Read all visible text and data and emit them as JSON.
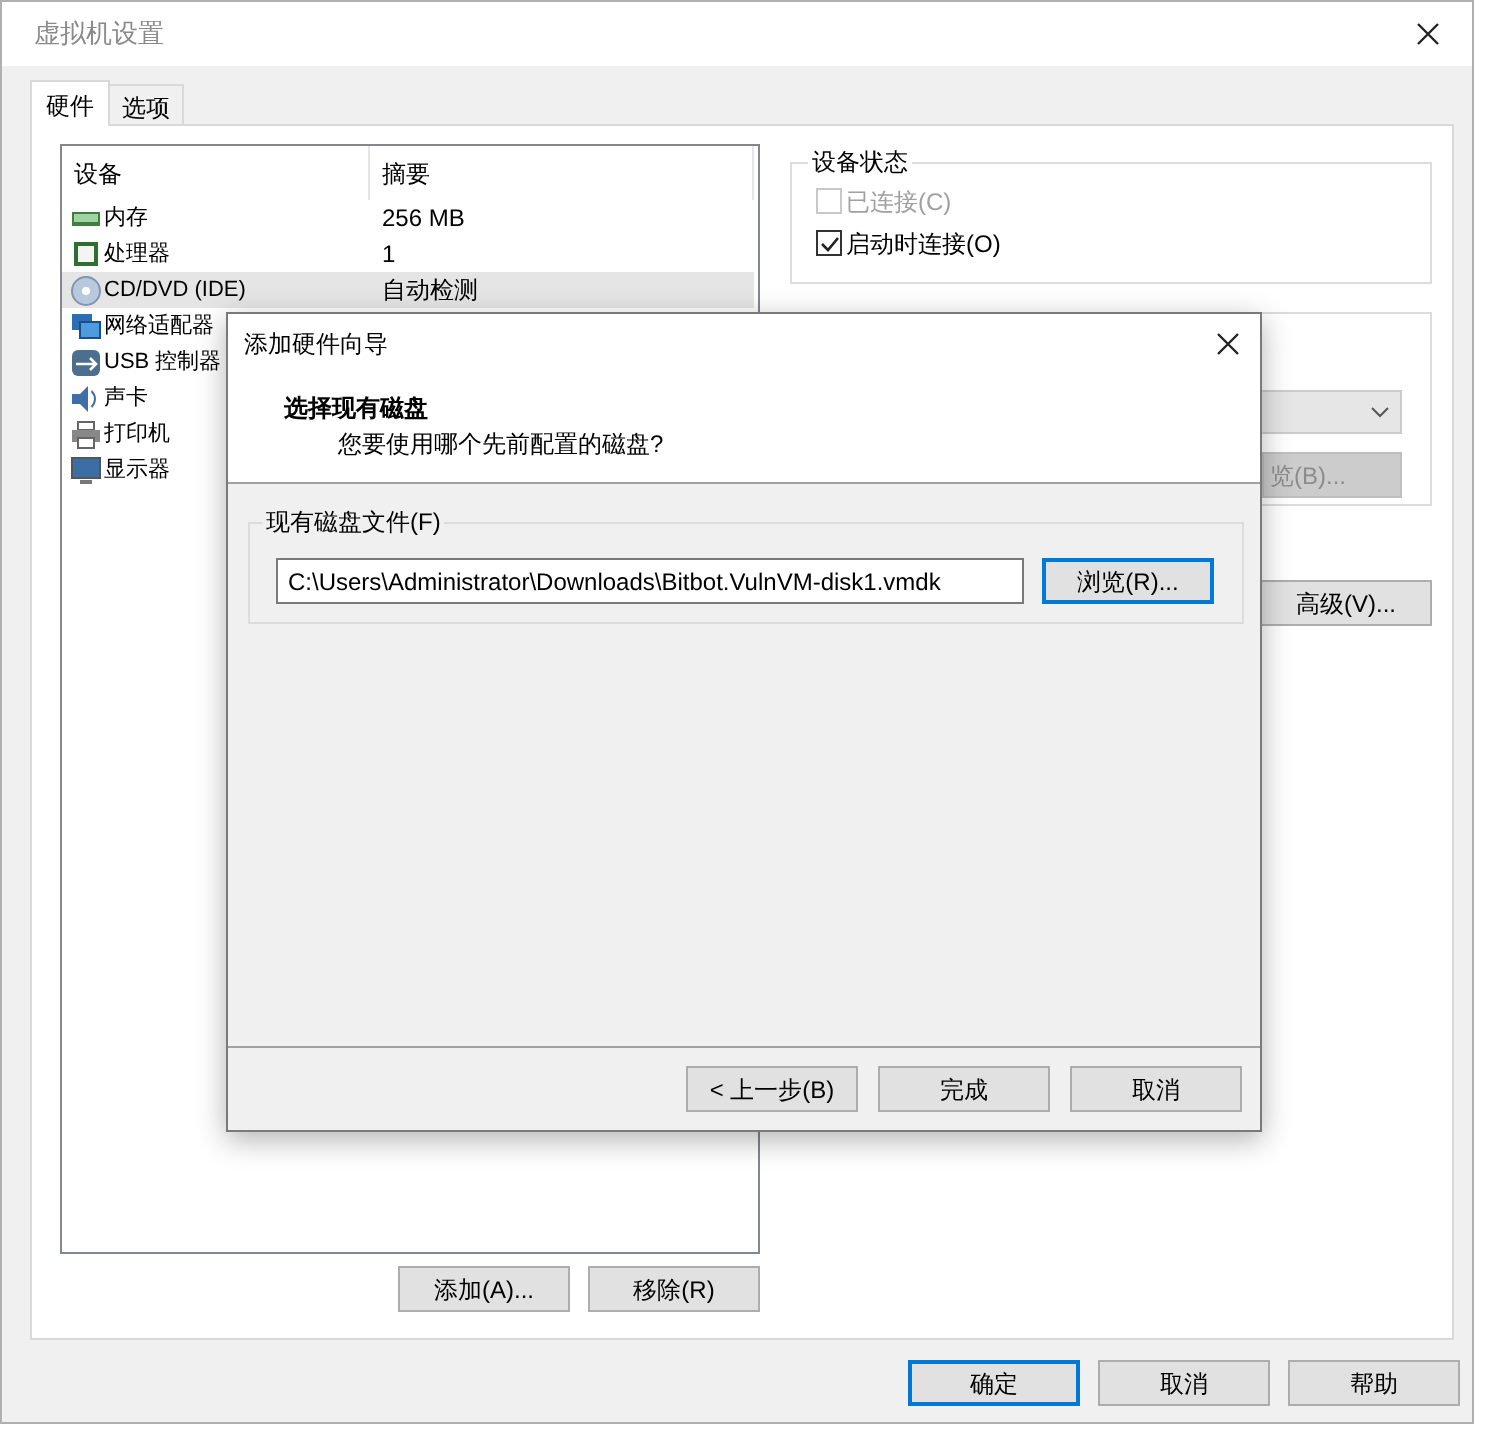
{
  "window": {
    "title": "虚拟机设置"
  },
  "tabs": [
    {
      "label": "硬件",
      "selected": true
    },
    {
      "label": "选项",
      "selected": false
    }
  ],
  "device_table": {
    "columns": [
      "设备",
      "摘要"
    ],
    "rows": [
      {
        "kind": "memory",
        "device": "内存",
        "summary": "256 MB",
        "selected": false
      },
      {
        "kind": "cpu",
        "device": "处理器",
        "summary": "1",
        "selected": false
      },
      {
        "kind": "disc",
        "device": "CD/DVD (IDE)",
        "summary": "自动检测",
        "selected": true
      },
      {
        "kind": "network",
        "device": "网络适配器",
        "selected": false
      },
      {
        "kind": "usb",
        "device": "USB 控制器",
        "selected": false
      },
      {
        "kind": "sound",
        "device": "声卡",
        "selected": false
      },
      {
        "kind": "printer",
        "device": "打印机",
        "selected": false
      },
      {
        "kind": "display",
        "device": "显示器",
        "selected": false
      }
    ]
  },
  "list_buttons": [
    "添加(A)...",
    "移除(R)"
  ],
  "device_status": {
    "title": "设备状态",
    "options": [
      {
        "label": "已连接(C)",
        "checked": false,
        "disabled": true
      },
      {
        "label": "启动时连接(O)",
        "checked": true,
        "disabled": false
      }
    ]
  },
  "connection": {
    "browse_button": "览(B)..."
  },
  "advanced_button": "高级(V)...",
  "dialog_buttons": [
    {
      "label": "确定",
      "default": true
    },
    {
      "label": "取消",
      "default": false
    },
    {
      "label": "帮助",
      "default": false
    }
  ],
  "wizard": {
    "title": "添加硬件向导",
    "heading": "选择现有磁盘",
    "subheading": "您要使用哪个先前配置的磁盘?",
    "group_label": "现有磁盘文件(F)",
    "path": "C:\\Users\\Administrator\\Downloads\\Bitbot.VulnVM-disk1.vmdk",
    "browse_button": {
      "label": "浏览(R)...",
      "default": true
    },
    "buttons": [
      {
        "label": "< 上一步(B)",
        "default": false
      },
      {
        "label": "完成",
        "default": false
      },
      {
        "label": "取消",
        "default": false
      }
    ]
  }
}
